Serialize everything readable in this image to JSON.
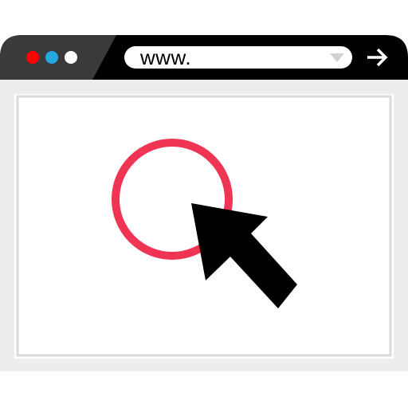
{
  "browser": {
    "address_bar": {
      "value": "www."
    },
    "window_controls": {
      "close_color": "#ff0000",
      "minimize_color": "#22a8e0",
      "maximize_color": "#ffffff"
    },
    "toolbar_color": "#1a1a1a",
    "tab_color": "#3a3a3a",
    "frame_color": "#ededed",
    "content_border_color": "#dadada"
  },
  "content": {
    "target_circle_color": "#ef3553",
    "cursor_color": "#000000"
  },
  "icons": {
    "dropdown": "triangle-down-icon",
    "go": "arrow-right-icon",
    "cursor": "mouse-pointer-icon",
    "target": "circle-target-icon"
  }
}
